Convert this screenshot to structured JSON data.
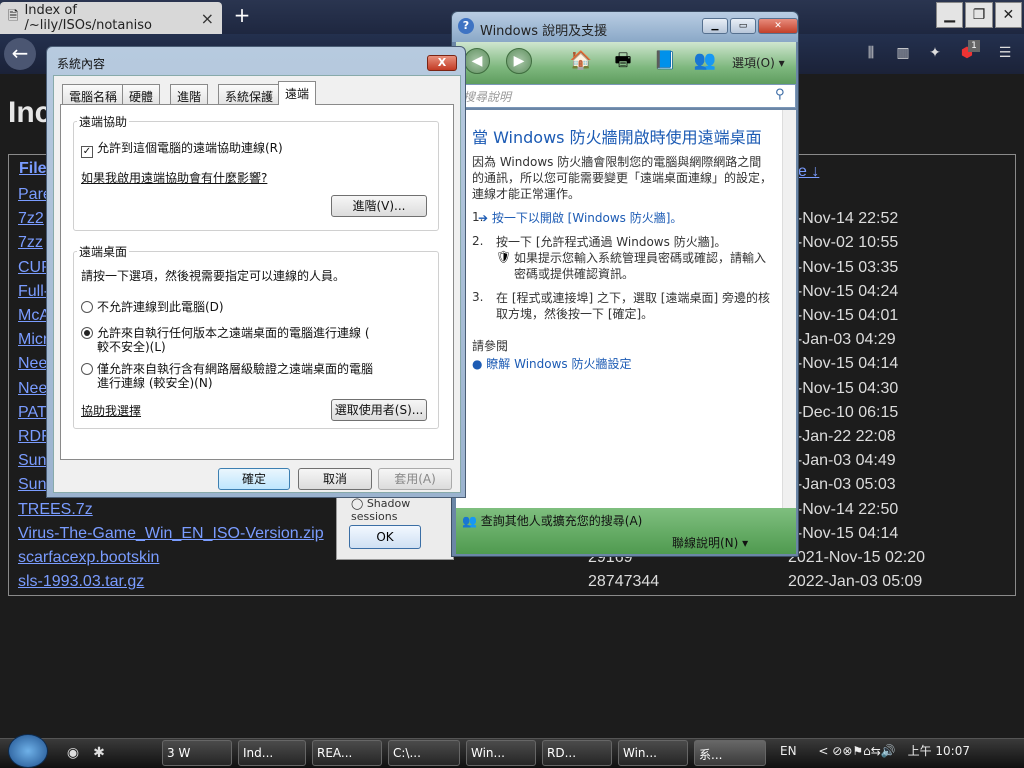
{
  "browser": {
    "tab_title": "Index of /~lily/ISOs/notaniso",
    "new_tab": "+",
    "back": "←",
    "ext_badge": "1",
    "heading": "Inc",
    "col_file": "File",
    "col_date_tail": "e ↓",
    "files": [
      {
        "name": "Pare",
        "size": "",
        "date": ""
      },
      {
        "name": "7z2",
        "size": "",
        "date": "1-Nov-14 22:52"
      },
      {
        "name": "7zz",
        "size": "",
        "date": "1-Nov-02 10:55"
      },
      {
        "name": "CUP",
        "size": "",
        "date": "1-Nov-15 03:35"
      },
      {
        "name": "Full-",
        "size": "",
        "date": "1-Nov-15 04:24"
      },
      {
        "name": "McA",
        "size": "",
        "date": "1-Nov-15 04:01"
      },
      {
        "name": "Micr",
        "size": "",
        "date": "2-Jan-03 04:29"
      },
      {
        "name": "Nee",
        "size": "",
        "date": "1-Nov-15 04:14"
      },
      {
        "name": "Nee",
        "size": "",
        "date": "1-Nov-15 04:30"
      },
      {
        "name": "PAT",
        "size": "",
        "date": "1-Dec-10 06:15"
      },
      {
        "name": "RDF",
        "size": "",
        "date": "2-Jan-22 22:08"
      },
      {
        "name": "Sun",
        "size": "",
        "date": "2-Jan-03 04:49"
      },
      {
        "name": "Sun",
        "size": "",
        "date": "2-Jan-03 05:03"
      },
      {
        "name": "TREES.7z",
        "size": "",
        "date": "1-Nov-14 22:50"
      },
      {
        "name": "Virus-The-Game_Win_EN_ISO-Version.zip",
        "size": "",
        "date": "1-Nov-15 04:14"
      },
      {
        "name": "scarfacexp.bootskin",
        "size": "29169",
        "date": "2021-Nov-15 02:20"
      },
      {
        "name": "sls-1993.03.tar.gz",
        "size": "28747344",
        "date": "2022-Jan-03 05:09"
      }
    ]
  },
  "help": {
    "title": "Windows 說明及支援",
    "options": "選項(O) ▾",
    "search_placeholder": "搜尋說明",
    "heading": "當 Windows 防火牆開啟時使用遠端桌面",
    "intro": "因為 Windows 防火牆會限制您的電腦與網際網路之間的通訊，所以您可能需要變更「遠端桌面連線」的設定，連線才能正常運作。",
    "steps": [
      {
        "n": "1.",
        "text": "➔ 按一下以開啟 [Windows 防火牆]。"
      },
      {
        "n": "2.",
        "text": "按一下 [允許程式通過 Windows 防火牆]。"
      },
      {
        "n": "",
        "text": "如果提示您輸入系統管理員密碼或確認，請輸入密碼或提供確認資訊。"
      },
      {
        "n": "3.",
        "text": "在 [程式或連接埠] 之下，選取 [遠端桌面] 旁邊的核取方塊，然後按一下 [確定]。"
      }
    ],
    "see_also": "請參閱",
    "see_link": "瞭解 Windows 防火牆設定",
    "footer_ask": "查詢其他人或擴充您的搜尋(A)",
    "footer_online": "聯線說明(N) ▾"
  },
  "remote_panel": {
    "shadow": "Shadow sessions",
    "ok": "OK"
  },
  "sysprop": {
    "title": "系統內容",
    "close": "X",
    "tabs": [
      "電腦名稱",
      "硬體",
      "進階",
      "系統保護",
      "遠端"
    ],
    "assist_group": "遠端協助",
    "assist_check": "允許到這個電腦的遠端協助連線(R)",
    "assist_link": "如果我啟用遠端協助會有什麼影響?",
    "advanced_btn": "進階(V)...",
    "desktop_group": "遠端桌面",
    "desktop_prompt": "請按一下選項，然後視需要指定可以連線的人員。",
    "radio1": "不允許連線到此電腦(D)",
    "radio2a": "允許來自執行任何版本之遠端桌面的電腦進行連線 (",
    "radio2b": "較不安全)(L)",
    "radio3a": "僅允許來自執行含有網路層級驗證之遠端桌面的電腦",
    "radio3b": "進行連線 (較安全)(N)",
    "help_link": "協助我選擇",
    "select_users": "選取使用者(S)...",
    "ok": "確定",
    "cancel": "取消",
    "apply": "套用(A)"
  },
  "taskbar": {
    "items": [
      "3 W",
      "Ind...",
      "REA...",
      "C:\\...",
      "Win...",
      "RD...",
      "Win...",
      "系..."
    ],
    "lang": "EN",
    "time": "上午 10:07"
  }
}
